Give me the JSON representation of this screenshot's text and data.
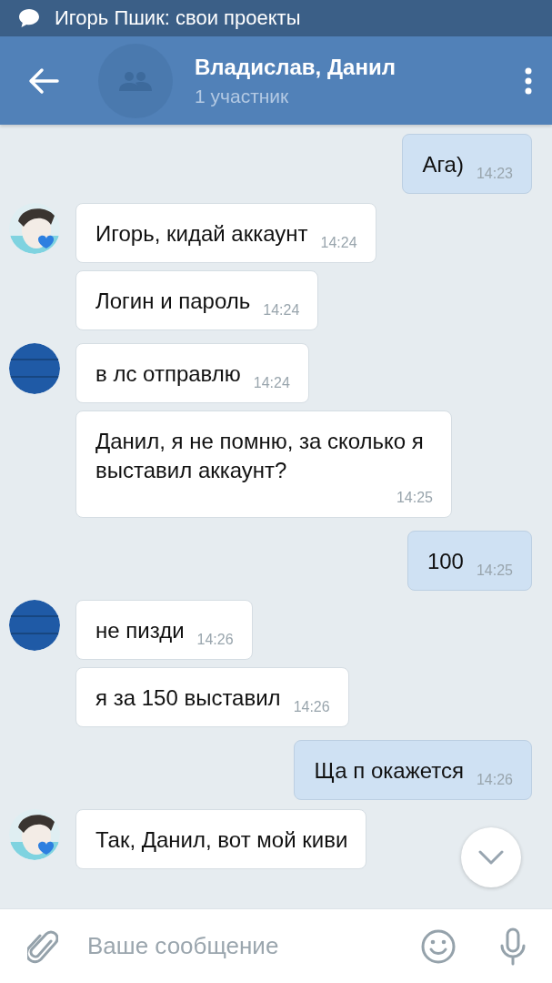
{
  "status_bar": {
    "notification": "Игорь Пшик: свои проекты"
  },
  "header": {
    "title": "Владислав, Данил",
    "subtitle": "1 участник"
  },
  "messages": [
    {
      "kind": "outgoing",
      "text": "Ага)",
      "time": "14:23"
    },
    {
      "kind": "incoming",
      "text": "Игорь, кидай аккаунт",
      "time": "14:24"
    },
    {
      "kind": "incoming",
      "text": "Логин и пароль",
      "time": "14:24"
    },
    {
      "kind": "incoming",
      "avatar": {
        "kind": "blue"
      },
      "text": "в лс отправлю",
      "time": "14:24"
    },
    {
      "kind": "incoming",
      "text": "Данил, я не помню, за сколько я выставил аккаунт?",
      "time": "14:25"
    },
    {
      "kind": "outgoing",
      "text": "100",
      "time": "14:25"
    },
    {
      "kind": "incoming",
      "avatar": {
        "kind": "blue"
      },
      "text": "не пизди",
      "time": "14:26"
    },
    {
      "kind": "incoming",
      "text": "я за 150 выставил",
      "time": "14:26"
    },
    {
      "kind": "outgoing",
      "text": "Ща п окажется",
      "time": "14:26"
    },
    {
      "kind": "incoming",
      "text": "Так, Данил, вот мой киви"
    }
  ],
  "composer": {
    "placeholder": "Ваше сообщение"
  }
}
